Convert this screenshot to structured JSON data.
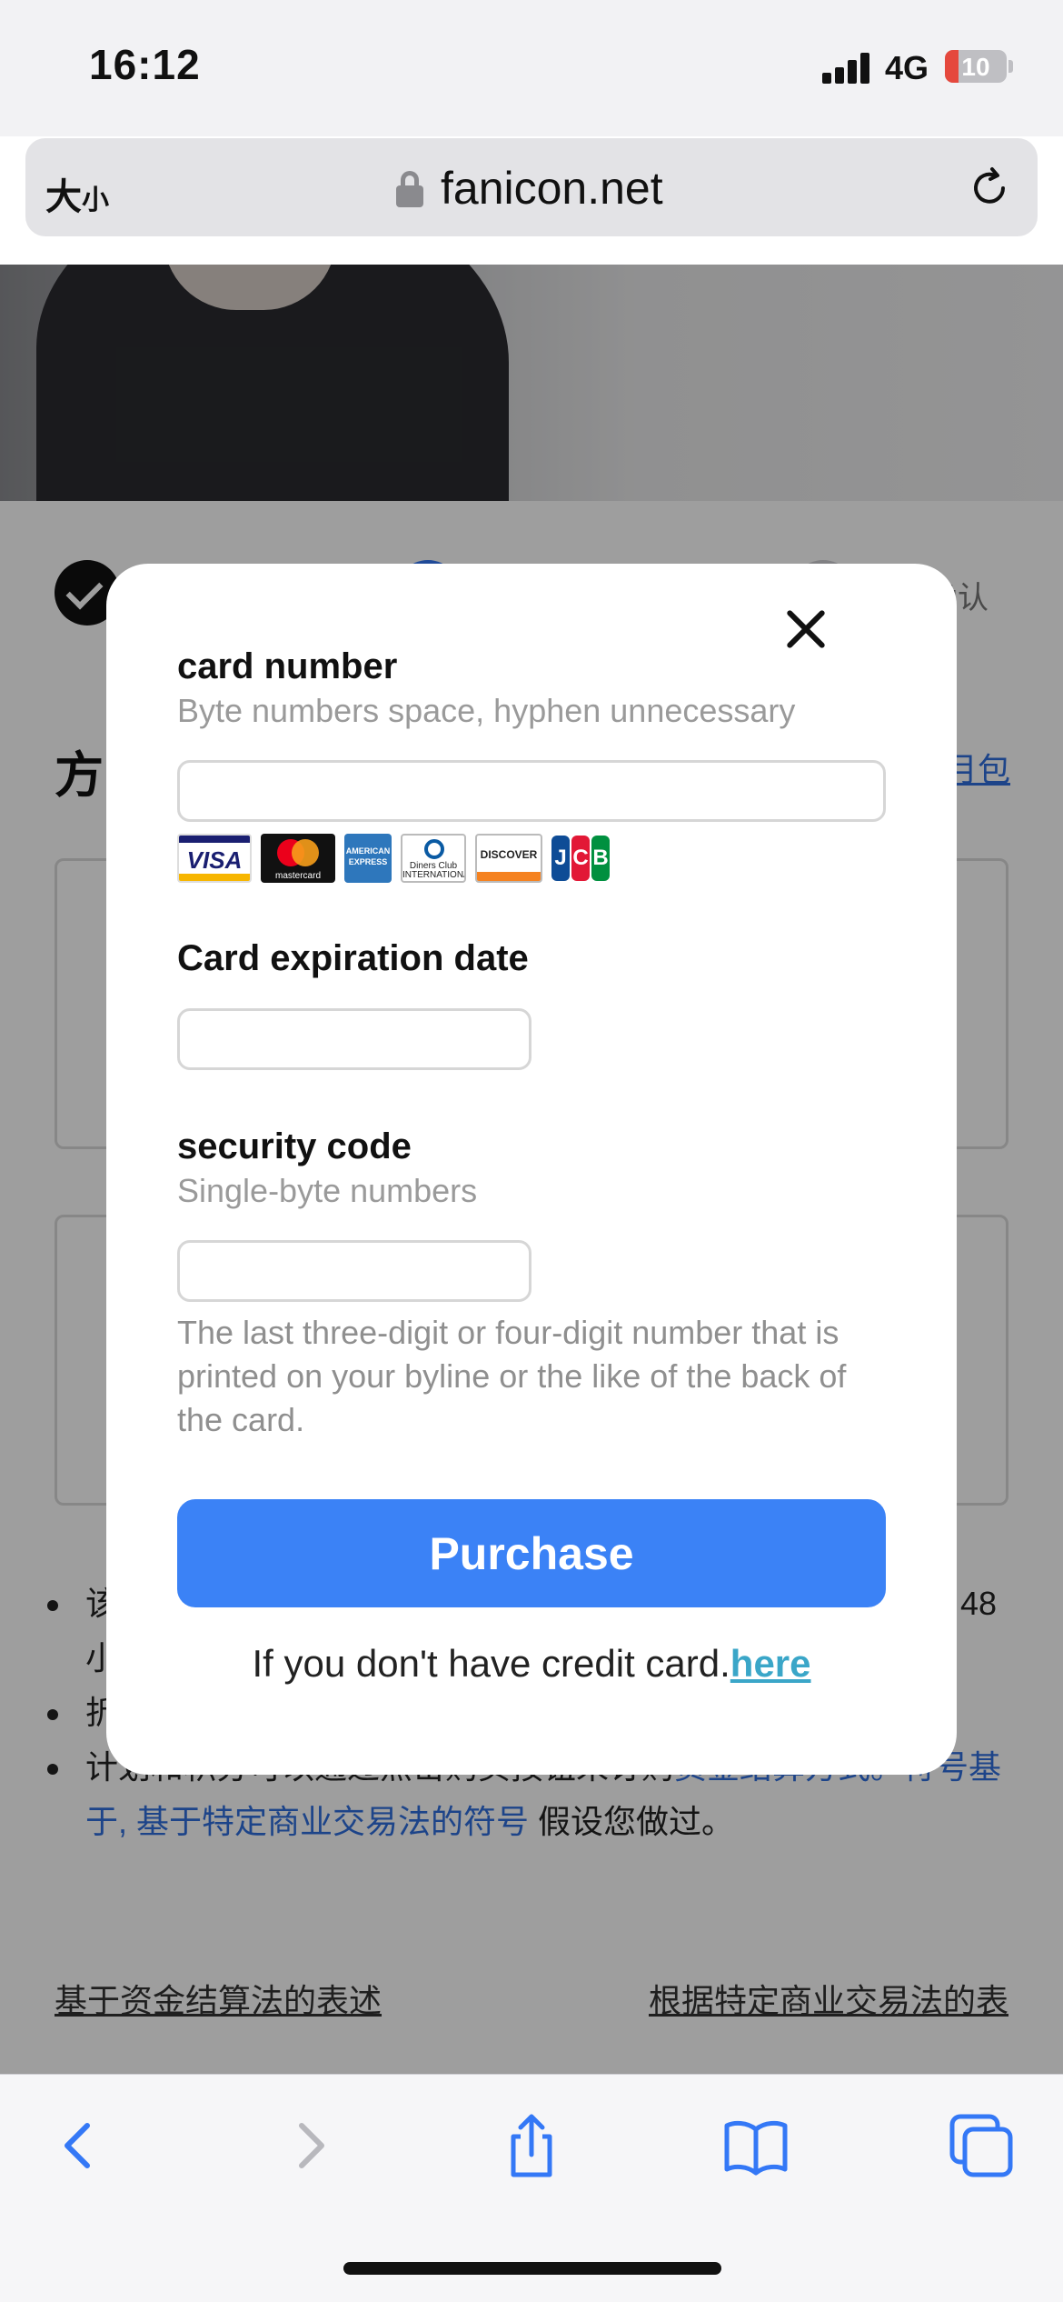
{
  "status_bar": {
    "time": "16:12",
    "network": "4G",
    "battery": "10",
    "battery_fraction": 0.22
  },
  "browser": {
    "text_size_label": "大",
    "text_size_small": "小",
    "url": "fanicon.net"
  },
  "background_page": {
    "step_label": "确认",
    "heading": "方",
    "right_link": "月包",
    "bullet_1_start": "该",
    "bullet_1_end": "48",
    "bullet_1_line2": "小",
    "bullet_2_start": "折",
    "bullet_3_text": "计划和积分可以通过点击购买按钮来订购",
    "bullet_3_link": "资金结算方式。符号基",
    "bullet_3_line2_link": "于, 基于特定商业交易法的符号",
    "bullet_3_line2_text": " 假设您做过。",
    "footer_left": "基于资金结算法的表述",
    "footer_right": "根据特定商业交易法的表"
  },
  "modal": {
    "card_number_label": "card number",
    "card_number_hint": "Byte numbers space, hyphen unnecessary",
    "card_number_value": "",
    "card_brands": [
      "VISA",
      "mastercard",
      "AMERICAN EXPRESS",
      "Diners Club INTERNATIONAL",
      "DISCOVER",
      "JCB"
    ],
    "expiry_label": "Card expiration date",
    "expiry_value": "",
    "security_label": "security code",
    "security_hint": "Single-byte numbers",
    "security_value": "",
    "security_help": "The last three-digit or four-digit number that is printed on your byline or the like of the back of the card.",
    "purchase_label": "Purchase",
    "no_card_text": "If you don't have credit card.",
    "no_card_link": "here"
  },
  "colors": {
    "accent": "#3b82f6",
    "link": "#3aa6c8",
    "battery_low": "#e5483d"
  }
}
